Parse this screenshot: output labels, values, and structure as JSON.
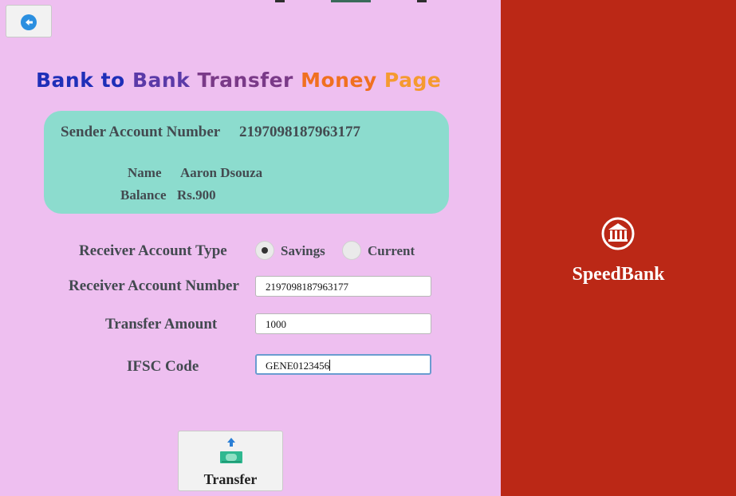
{
  "window": {
    "title": "Bank to Bank Transfer Money Page"
  },
  "header": {
    "back_icon": "arrow-left-circle-icon",
    "title_words": [
      "Bank",
      "to",
      "Bank",
      "Transfer",
      "Money",
      "Page"
    ]
  },
  "sender": {
    "account_label": "Sender Account Number",
    "account_number": "2197098187963177",
    "name_label": "Name",
    "name": "Aaron Dsouza",
    "balance_label": "Balance",
    "balance": "Rs.900"
  },
  "form": {
    "account_type_label": "Receiver Account Type",
    "account_type_options": [
      "Savings",
      "Current"
    ],
    "account_type_selected": "Savings",
    "account_number_label": "Receiver Account Number",
    "account_number_value": "2197098187963177",
    "amount_label": "Transfer Amount",
    "amount_value": "1000",
    "ifsc_label": "IFSC Code",
    "ifsc_value": "GENE0123456"
  },
  "actions": {
    "transfer_label": "Transfer",
    "transfer_icon": "money-upload-icon"
  },
  "brand": {
    "name": "SpeedBank",
    "logo_icon": "bank-building-icon"
  },
  "colors": {
    "left_panel": "#eebff0",
    "right_panel": "#bb2816",
    "card": "#8cdcce",
    "accent": "#2b8fe0"
  }
}
